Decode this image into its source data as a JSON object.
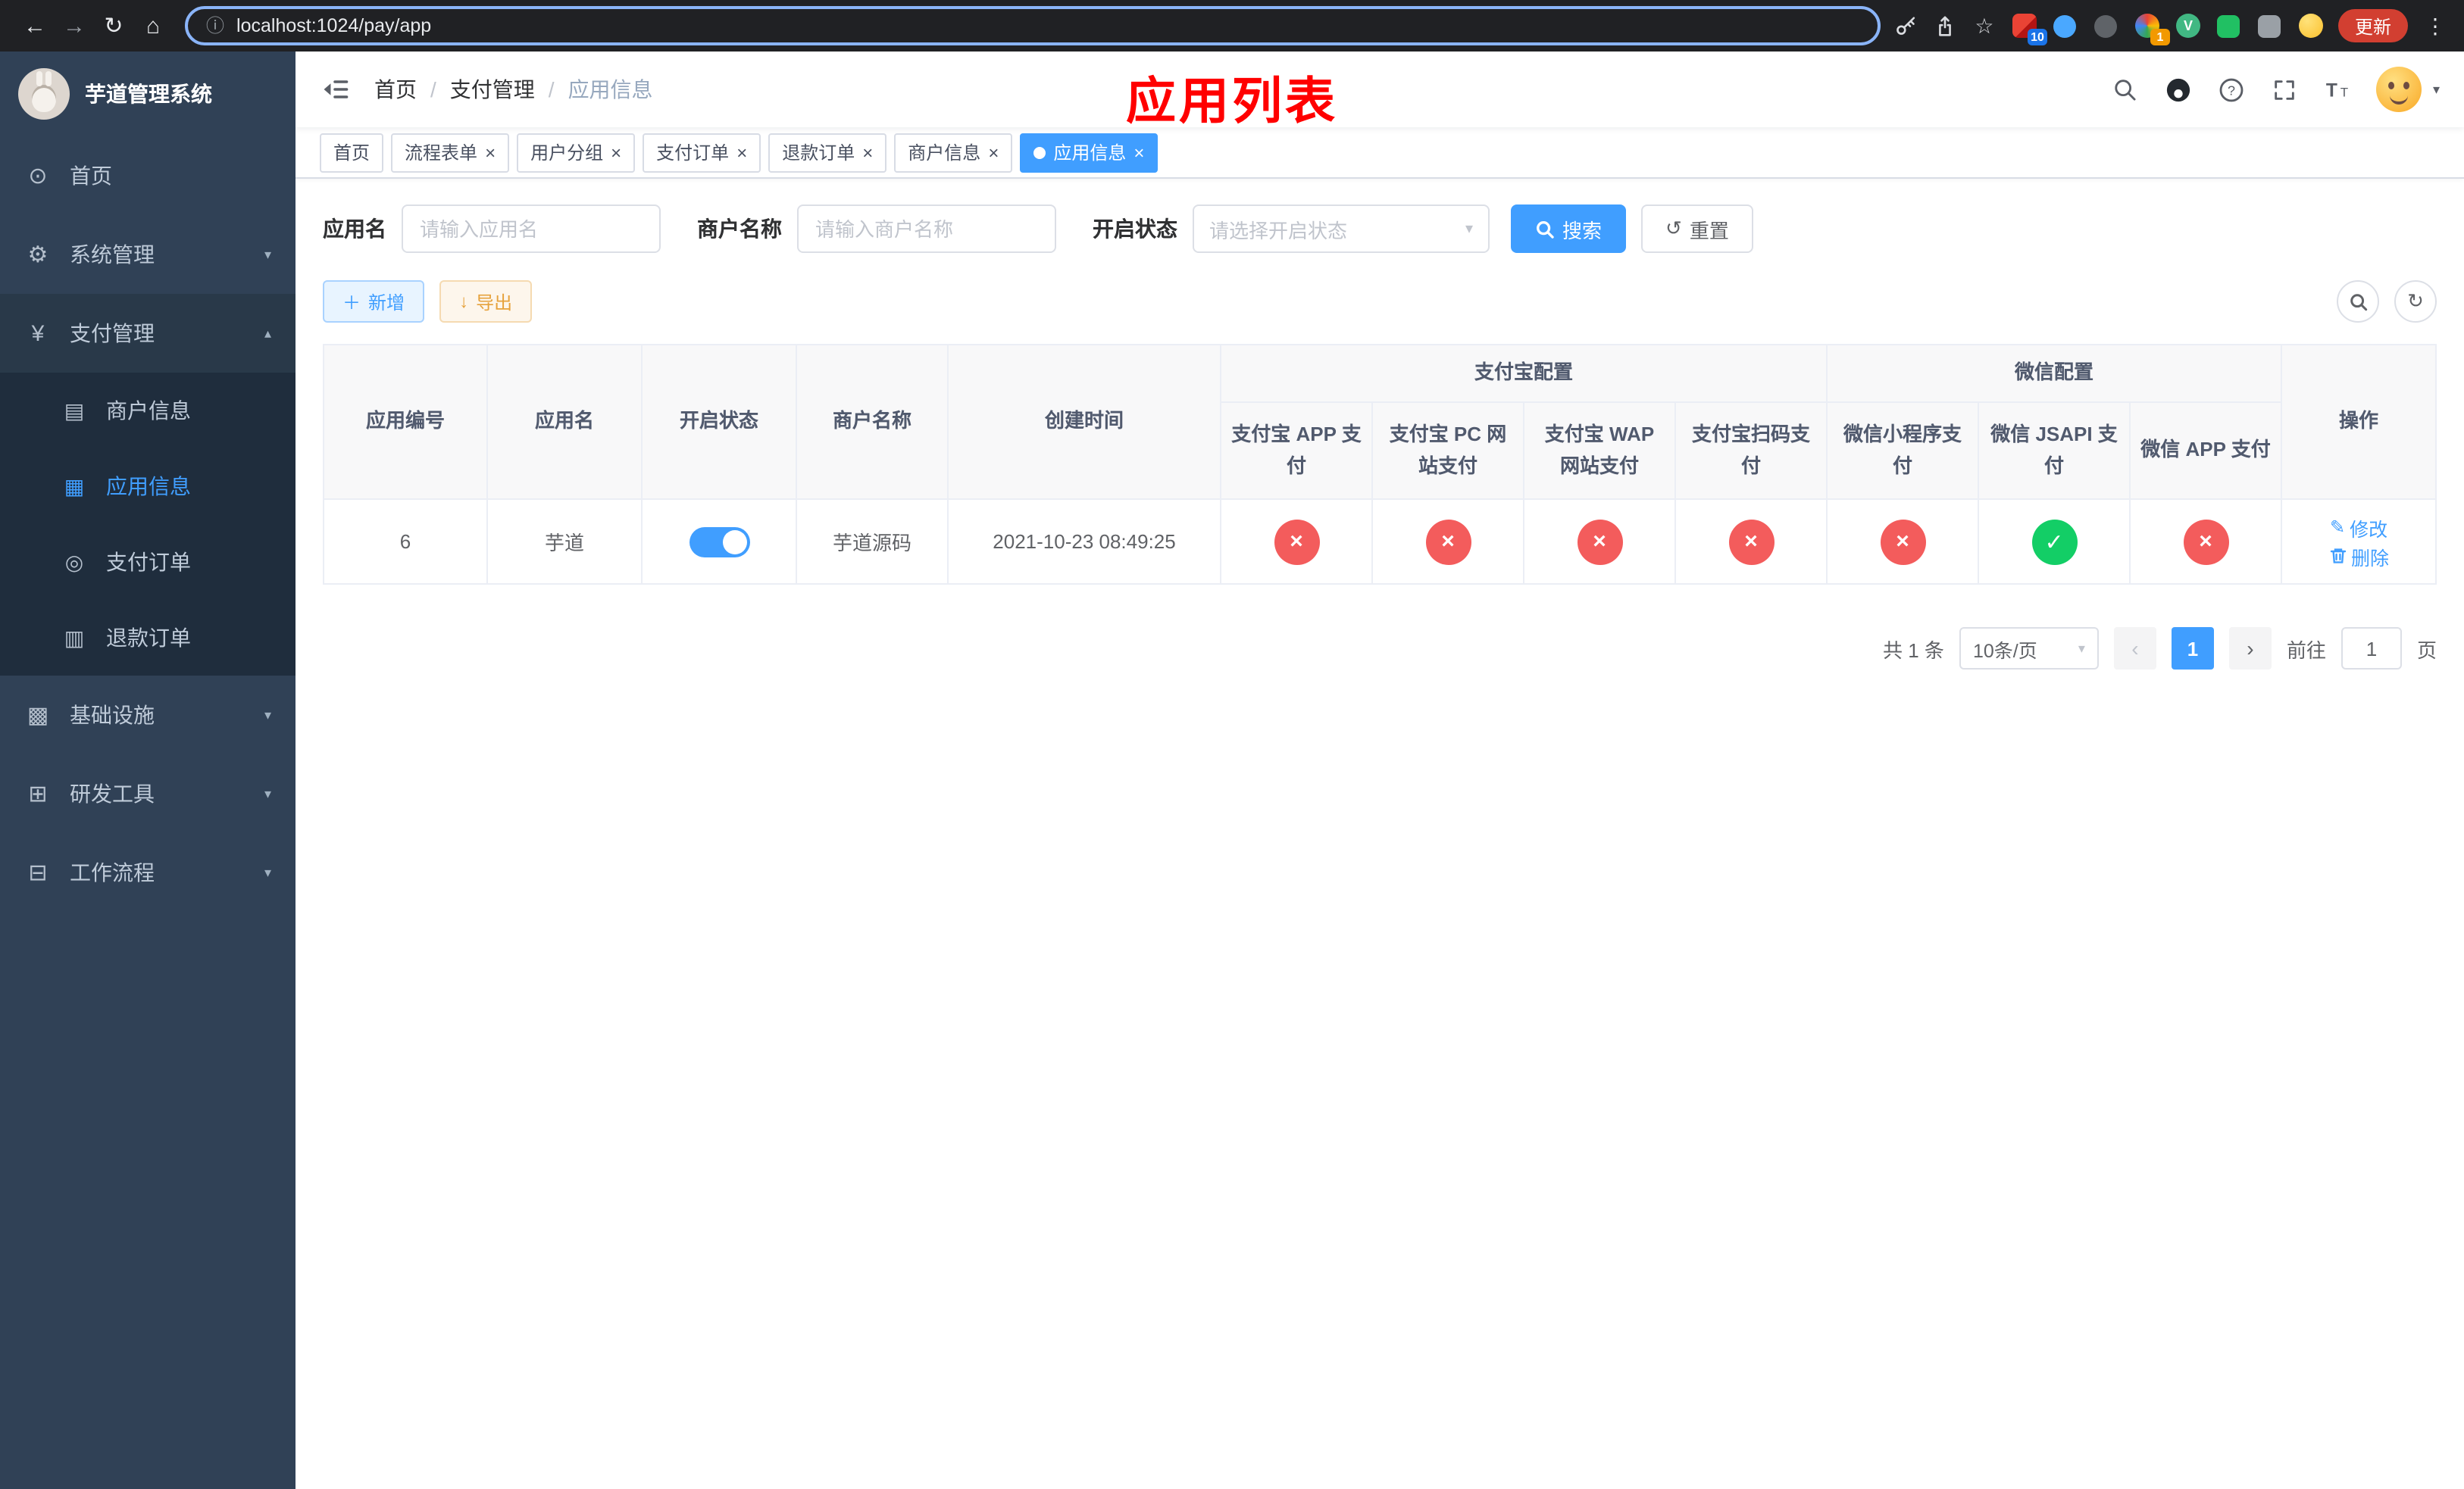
{
  "colors": {
    "primary": "#409eff",
    "disabled_red": "#f35c5c",
    "enabled_green": "#13ce66",
    "annotation_red": "#ff0000"
  },
  "browser": {
    "url": "localhost:1024/pay/app",
    "update_label": "更新",
    "badge_10": "10",
    "badge_1": "1"
  },
  "sidebar": {
    "app_title": "芋道管理系统",
    "menu": [
      {
        "label": "首页"
      },
      {
        "label": "系统管理"
      },
      {
        "label": "支付管理"
      },
      {
        "label": "基础设施"
      },
      {
        "label": "研发工具"
      },
      {
        "label": "工作流程"
      }
    ],
    "pay_children": [
      {
        "label": "商户信息"
      },
      {
        "label": "应用信息"
      },
      {
        "label": "支付订单"
      },
      {
        "label": "退款订单"
      }
    ]
  },
  "header": {
    "breadcrumb": [
      {
        "label": "首页"
      },
      {
        "label": "支付管理"
      },
      {
        "label": "应用信息"
      }
    ],
    "annotation": "应用列表"
  },
  "tabs": [
    {
      "label": "首页"
    },
    {
      "label": "流程表单"
    },
    {
      "label": "用户分组"
    },
    {
      "label": "支付订单"
    },
    {
      "label": "退款订单"
    },
    {
      "label": "商户信息"
    },
    {
      "label": "应用信息"
    }
  ],
  "filters": {
    "app_name": {
      "label": "应用名",
      "placeholder": "请输入应用名",
      "value": ""
    },
    "merchant_name": {
      "label": "商户名称",
      "placeholder": "请输入商户名称",
      "value": ""
    },
    "status": {
      "label": "开启状态",
      "placeholder": "请选择开启状态",
      "value": ""
    },
    "search_label": "搜索",
    "reset_label": "重置"
  },
  "toolbar": {
    "add_label": "新增",
    "export_label": "导出"
  },
  "table": {
    "columns": {
      "app_id": "应用编号",
      "app_name": "应用名",
      "status": "开启状态",
      "merchant": "商户名称",
      "created": "创建时间",
      "actions": "操作"
    },
    "groups": {
      "alipay": "支付宝配置",
      "wechat": "微信配置"
    },
    "channel_columns": [
      {
        "label": "支付宝 APP 支付"
      },
      {
        "label": "支付宝 PC 网站支付"
      },
      {
        "label": "支付宝 WAP 网站支付"
      },
      {
        "label": "支付宝扫码支付"
      },
      {
        "label": "微信小程序支付"
      },
      {
        "label": "微信 JSAPI 支付"
      },
      {
        "label": "微信 APP 支付"
      }
    ],
    "rows": [
      {
        "app_id": "6",
        "app_name": "芋道",
        "enabled": true,
        "merchant": "芋道源码",
        "created": "2021-10-23 08:49:25",
        "channels": [
          "disabled",
          "disabled",
          "disabled",
          "disabled",
          "disabled",
          "enabled",
          "disabled"
        ],
        "edit_label": "修改",
        "delete_label": "删除"
      }
    ]
  },
  "pagination": {
    "total_text": "共 1 条",
    "page_size_text": "10条/页",
    "current_page": "1",
    "goto_label": "前往",
    "goto_value": "1",
    "unit_label": "页"
  }
}
